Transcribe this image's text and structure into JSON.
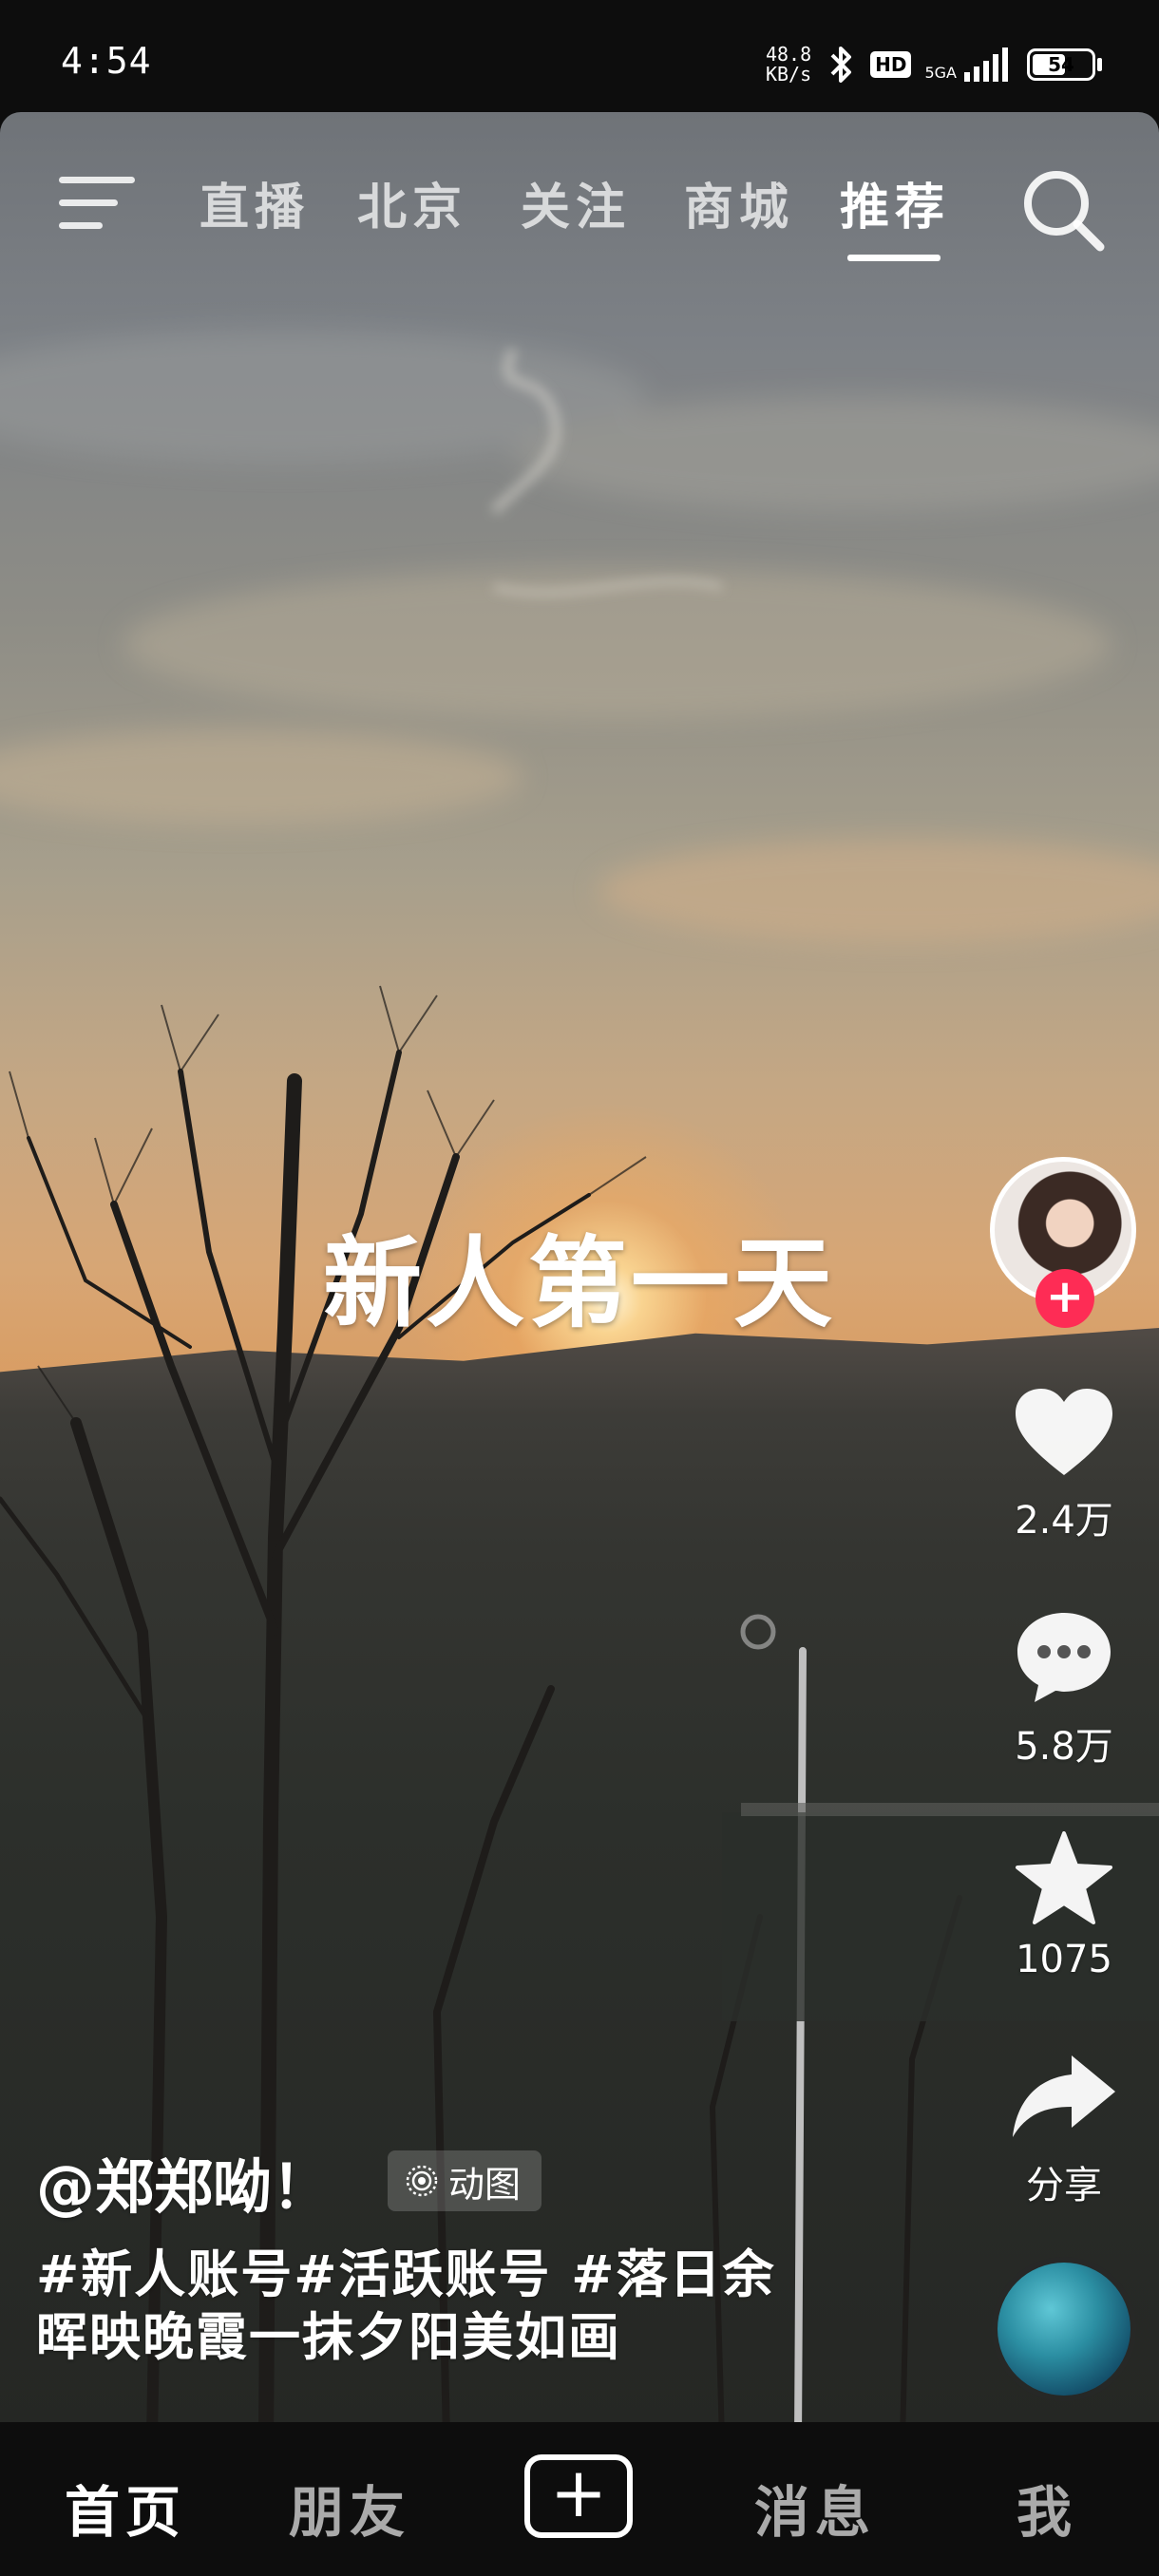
{
  "status_bar": {
    "time": "4:54",
    "net_speed_value": "48.8",
    "net_speed_unit": "KB/s",
    "hd_label": "HD",
    "signal_label": "5GA",
    "battery_level": "54"
  },
  "top_tabs": {
    "items": [
      {
        "label": "直播"
      },
      {
        "label": "北京"
      },
      {
        "label": "关注"
      },
      {
        "label": "商城"
      },
      {
        "label": "推荐"
      }
    ],
    "active_index": 4
  },
  "video": {
    "overlay_caption": "新人第一天",
    "author": "@郑郑呦！",
    "gif_badge": "动图",
    "description_line1": "#新人账号#活跃账号 #落日余",
    "description_line2": "晖映晚霞一抹夕阳美如画"
  },
  "actions": {
    "likes": "2.4万",
    "comments": "5.8万",
    "favorites": "1075",
    "share": "分享"
  },
  "bottom_nav": {
    "home": "首页",
    "friends": "朋友",
    "messages": "消息",
    "me": "我"
  },
  "colors": {
    "follow_accent": "#fe2c55",
    "background": "#0d0d0d"
  }
}
